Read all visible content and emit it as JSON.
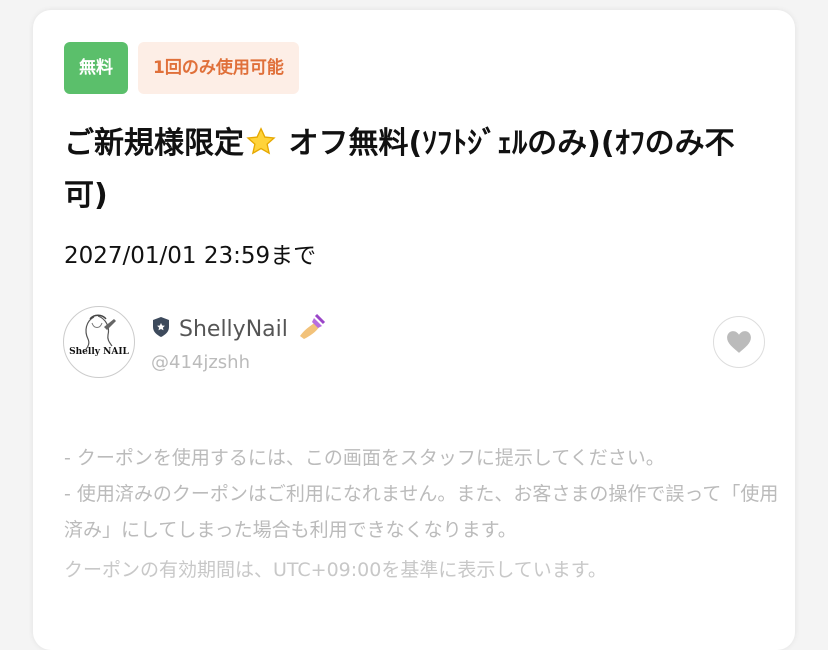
{
  "badges": {
    "free": "無料",
    "usage_limit": "1回のみ使用可能"
  },
  "coupon": {
    "title_part1": "ご新規様限定",
    "title_part2": " オフ無料(ｿﾌﾄｼﾞｪﾙのみ)(ｵﾌのみ不可)",
    "expiry": "2027/01/01 23:59まで"
  },
  "shop": {
    "avatar_text": "Shelly NAIL",
    "name": "ShellyNail",
    "handle": "@414jzshh"
  },
  "notes": {
    "line1": "- クーポンを使用するには、この画面をスタッフに提示してください。",
    "line2": "- 使用済みのクーポンはご利用になれません。また、お客さまの操作で誤って「使用済み」にしてしまった場合も利用できなくなります。",
    "timezone_note": "クーポンの有効期間は、UTC+09:00を基準に表示しています。"
  },
  "colors": {
    "free_badge": "#5bbf6b",
    "usage_badge_bg": "#fdeee6",
    "usage_badge_text": "#e0703a"
  },
  "icons": {
    "title": "star-icon",
    "shop_badge": "shield-icon",
    "shop_emoji": "nail-polish-icon",
    "like": "heart-icon"
  }
}
